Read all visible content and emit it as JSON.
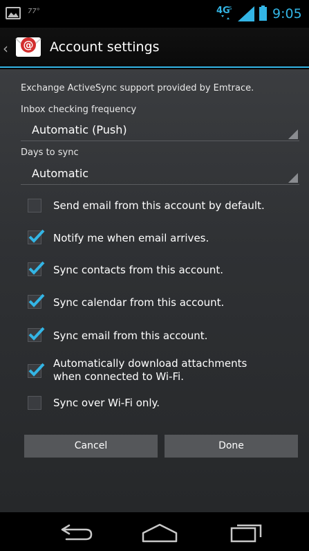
{
  "status_bar": {
    "temperature": "77°",
    "network": "4G",
    "time": "9:05"
  },
  "action_bar": {
    "title": "Account settings",
    "icon": "email-app-icon"
  },
  "info_text": "Exchange ActiveSync support provided by Emtrace.",
  "inbox_frequency": {
    "label": "Inbox checking frequency",
    "value": "Automatic (Push)"
  },
  "days_to_sync": {
    "label": "Days to sync",
    "value": "Automatic"
  },
  "options": [
    {
      "label": "Send email from this account by default.",
      "checked": false
    },
    {
      "label": "Notify me when email arrives.",
      "checked": true
    },
    {
      "label": "Sync contacts from this account.",
      "checked": true
    },
    {
      "label": "Sync calendar from this account.",
      "checked": true
    },
    {
      "label": "Sync email from this account.",
      "checked": true
    },
    {
      "label": "Automatically download attachments when connected to Wi-Fi.",
      "checked": true
    },
    {
      "label": "Sync over Wi-Fi only.",
      "checked": false
    }
  ],
  "buttons": {
    "cancel": "Cancel",
    "done": "Done"
  },
  "colors": {
    "accent": "#33b5e5",
    "background": "#2f3134",
    "button": "#55575a"
  }
}
